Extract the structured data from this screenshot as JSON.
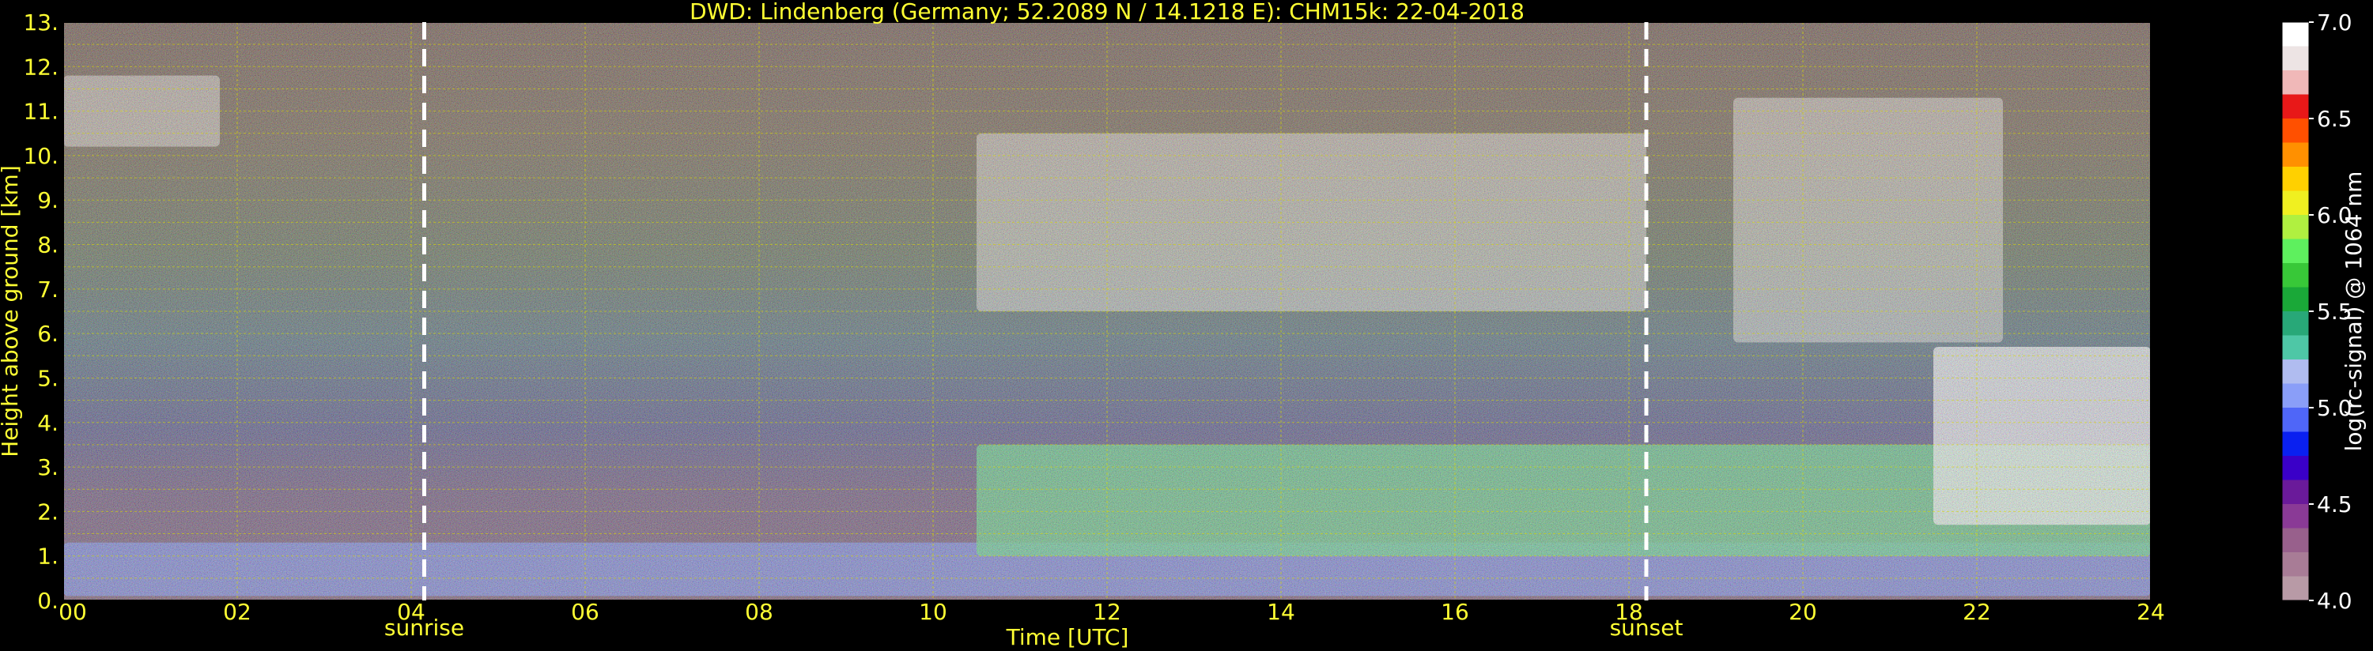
{
  "chart_data": {
    "type": "heatmap",
    "title": "DWD: Lindenberg (Germany; 52.2089 N / 14.1218 E):     CHM15k: 22-04-2018",
    "xlabel": "Time [UTC]",
    "ylabel": "Height above ground [km]",
    "xlim": [
      0,
      24
    ],
    "ylim": [
      0,
      13
    ],
    "x_ticks": [
      "00",
      "02",
      "04",
      "06",
      "08",
      "10",
      "12",
      "14",
      "16",
      "18",
      "20",
      "22",
      "24"
    ],
    "y_ticks": [
      "0.",
      "1.",
      "2.",
      "3.",
      "4.",
      "5.",
      "6.",
      "7.",
      "8.",
      "9.",
      "10.",
      "11.",
      "12.",
      "13."
    ],
    "grid": true,
    "annotations": [
      {
        "label": "sunrise",
        "time": 4.15
      },
      {
        "label": "sunset",
        "time": 18.2
      }
    ],
    "colorbar": {
      "label": "log(rc-signal) @ 1064 nm",
      "ticks": [
        "4.0",
        "4.5",
        "5.0",
        "5.5",
        "6.0",
        "6.5",
        "7.0"
      ],
      "range": [
        4.0,
        7.0
      ],
      "colors": [
        "#b89aa6",
        "#a87c96",
        "#98608c",
        "#8a3a96",
        "#6a1a9a",
        "#3a00c8",
        "#0a20f0",
        "#4f66f8",
        "#8a9ef8",
        "#b0bcf0",
        "#4ec7a6",
        "#28a878",
        "#1aa838",
        "#38c838",
        "#5ef05e",
        "#b0f040",
        "#f0f020",
        "#ffd000",
        "#ff9000",
        "#ff5000",
        "#e81818",
        "#f0b8b8",
        "#ede4e4",
        "#ffffff"
      ]
    },
    "features": [
      {
        "kind": "boundary_layer",
        "t_start": 0,
        "t_end": 24,
        "h_low": 0.1,
        "h_high": 1.3
      },
      {
        "kind": "residual_layer",
        "t_start": 10.5,
        "t_end": 24,
        "h_low": 1.0,
        "h_high": 3.5
      },
      {
        "kind": "cirrus",
        "t_start": 0,
        "t_end": 1.8,
        "h_low": 10.2,
        "h_high": 11.8
      },
      {
        "kind": "cirrus",
        "t_start": 10.5,
        "t_end": 18.2,
        "h_low": 6.5,
        "h_high": 10.5
      },
      {
        "kind": "cirrus",
        "t_start": 19.2,
        "t_end": 22.3,
        "h_low": 5.8,
        "h_high": 11.3
      },
      {
        "kind": "low_cloud",
        "t_start": 21.5,
        "t_end": 24,
        "h_low": 1.7,
        "h_high": 5.7
      }
    ]
  }
}
